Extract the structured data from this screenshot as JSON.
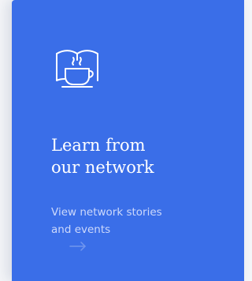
{
  "card": {
    "icon": "book-coffee-icon",
    "title_line1": "Learn from",
    "title_line2": "our network",
    "desc_line1": "View network stories",
    "desc_line2": "and events",
    "link_icon": "arrow-right-icon",
    "accent_color": "#3a6ee8"
  }
}
